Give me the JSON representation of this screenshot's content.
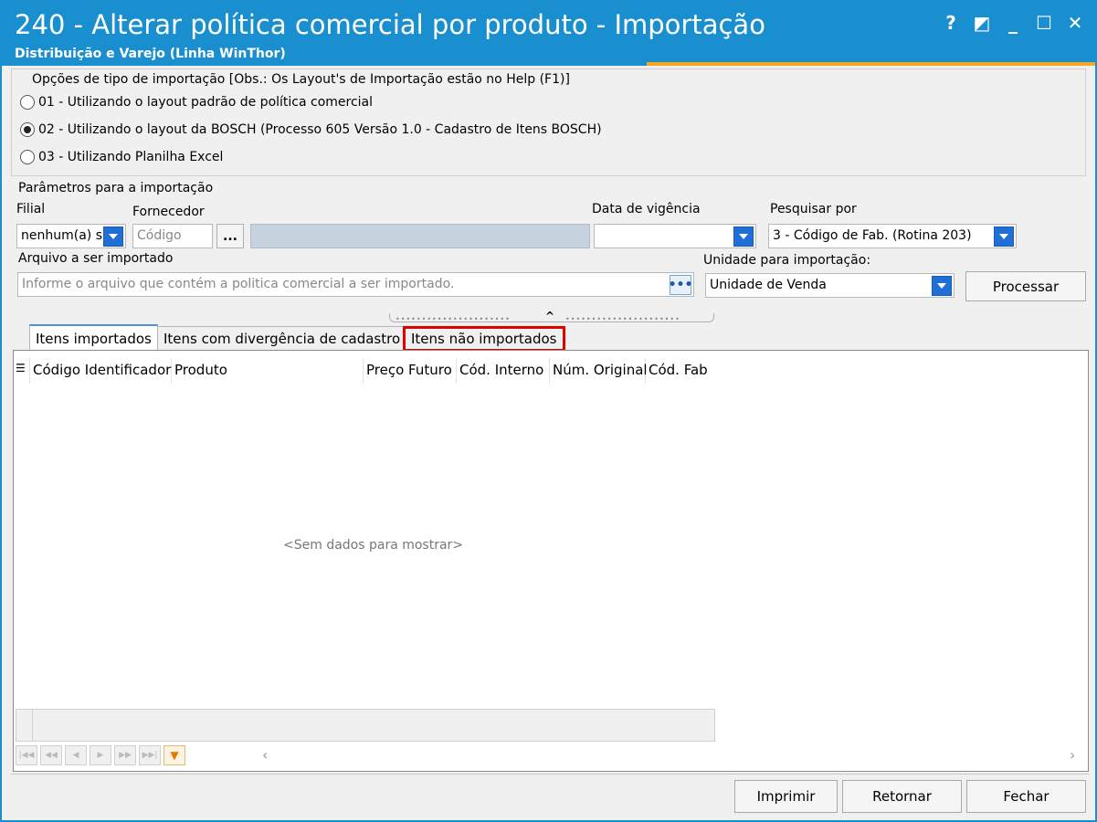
{
  "window": {
    "title": "240 - Alterar política comercial por produto - Importação",
    "subtitle": "Distribuição e Varejo (Linha WinThor)",
    "controls": [
      "?",
      "◩",
      "_",
      "☐",
      "✕"
    ]
  },
  "import_options": {
    "legend": "Opções de tipo de importação  [Obs.: Os Layout's de Importação estão no Help (F1)]",
    "options": [
      {
        "label": "01 - Utilizando o layout padrão de política comercial",
        "selected": false
      },
      {
        "label": "02 - Utilizando o layout da BOSCH (Processo 605 Versão 1.0 - Cadastro de Itens BOSCH)",
        "selected": true
      },
      {
        "label": "03 - Utilizando Planilha Excel",
        "selected": false
      }
    ]
  },
  "params": {
    "legend": "Parâmetros para a importação",
    "filial_label": "Filial",
    "filial_value": "nenhum(a) s",
    "fornecedor_label": "Fornecedor",
    "fornecedor_placeholder": "Código",
    "ellipsis": "...",
    "data_vigencia_label": "Data de vigência",
    "data_vigencia_value": "",
    "pesquisar_label": "Pesquisar por",
    "pesquisar_value": "3 - Código de Fab. (Rotina 203)",
    "arquivo_label": "Arquivo a ser importado",
    "arquivo_placeholder": "Informe o arquivo que contém a politica comercial a ser importado.",
    "arquivo_btn": "•••",
    "unidade_label": "Unidade para importação:",
    "unidade_value": "Unidade de Venda",
    "processar_label": "Processar"
  },
  "tabs": [
    {
      "label": "Itens importados",
      "active": true
    },
    {
      "label": "Itens com divergência de cadastro",
      "active": false
    },
    {
      "label": "Itens não importados",
      "active": false,
      "highlighted": true
    }
  ],
  "grid": {
    "columns": [
      "Código Identificador",
      "Produto",
      "Preço Futuro",
      "Cód. Interno",
      "Núm. Original",
      "Cód. Fab"
    ],
    "empty_text": "<Sem dados para mostrar>"
  },
  "footer": {
    "imprimir": "Imprimir",
    "retornar": "Retornar",
    "fechar": "Fechar"
  },
  "colors": {
    "titlebar": "#1a8fd0",
    "accent": "#f5a623",
    "highlight": "#e00000",
    "dropdown_button": "#1f6fd6"
  }
}
